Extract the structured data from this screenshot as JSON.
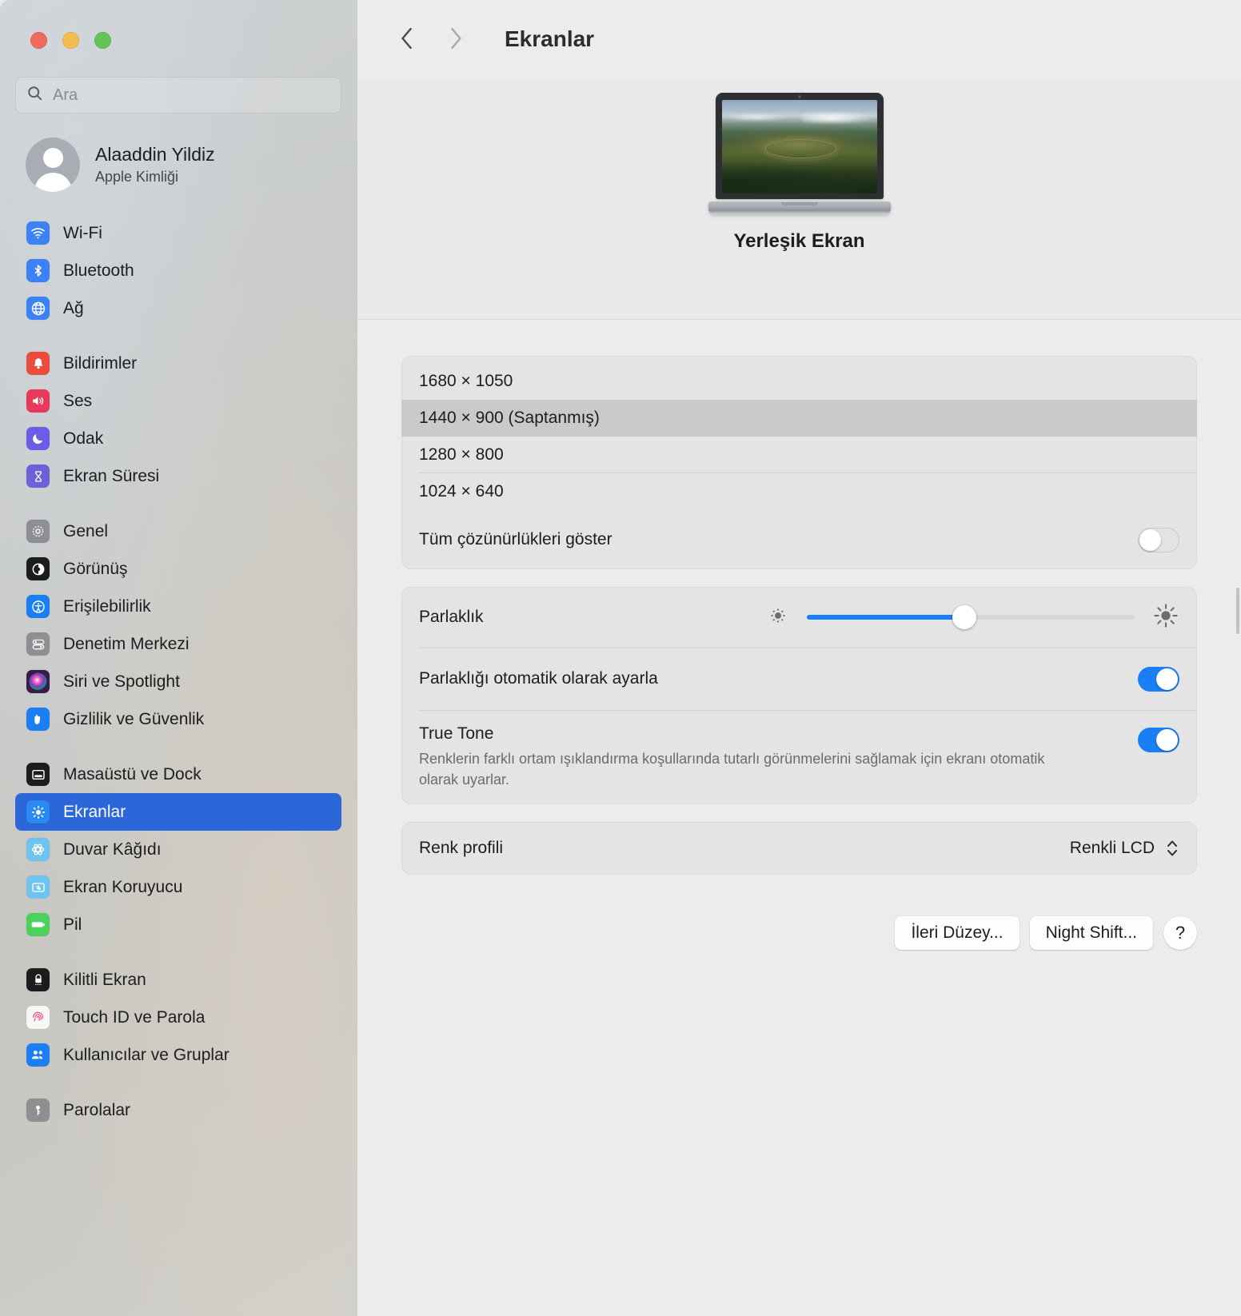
{
  "window": {
    "traffic_lights": [
      "close",
      "minimize",
      "zoom"
    ]
  },
  "sidebar": {
    "search": {
      "placeholder": "Ara",
      "value": "",
      "icon": "search-icon"
    },
    "account": {
      "name": "Alaaddin Yildiz",
      "subtitle": "Apple Kimliği",
      "avatar_icon": "person-avatar-icon"
    },
    "groups": [
      {
        "items": [
          {
            "label": "Wi-Fi",
            "icon": "wifi-icon",
            "color": "#3b82f6"
          },
          {
            "label": "Bluetooth",
            "icon": "bluetooth-icon",
            "color": "#3b82f6"
          },
          {
            "label": "Ağ",
            "icon": "globe-icon",
            "color": "#3b82f6"
          }
        ]
      },
      {
        "items": [
          {
            "label": "Bildirimler",
            "icon": "bell-icon",
            "color": "#eb4d3d"
          },
          {
            "label": "Ses",
            "icon": "speaker-icon",
            "color": "#e8395a"
          },
          {
            "label": "Odak",
            "icon": "moon-icon",
            "color": "#6c5ce7"
          },
          {
            "label": "Ekran Süresi",
            "icon": "hourglass-icon",
            "color": "#6f5fd8"
          }
        ]
      },
      {
        "items": [
          {
            "label": "Genel",
            "icon": "gear-icon",
            "color": "#8e8e93"
          },
          {
            "label": "Görünüş",
            "icon": "appearance-icon",
            "color": "#1c1c1e"
          },
          {
            "label": "Erişilebilirlik",
            "icon": "accessibility-icon",
            "color": "#1a7ef5"
          },
          {
            "label": "Denetim Merkezi",
            "icon": "control-center-icon",
            "color": "#8e8e93"
          },
          {
            "label": "Siri ve Spotlight",
            "icon": "siri-icon",
            "color": "#6b3fa0"
          },
          {
            "label": "Gizlilik ve Güvenlik",
            "icon": "hand-icon",
            "color": "#1a7ef5"
          }
        ]
      },
      {
        "items": [
          {
            "label": "Masaüstü ve Dock",
            "icon": "desktop-dock-icon",
            "color": "#1c1c1e"
          },
          {
            "label": "Ekranlar",
            "icon": "brightness-icon",
            "color": "#2b8af0",
            "selected": true
          },
          {
            "label": "Duvar Kâğıdı",
            "icon": "wallpaper-icon",
            "color": "#6fc3ef"
          },
          {
            "label": "Ekran Koruyucu",
            "icon": "screensaver-icon",
            "color": "#6fc3ef"
          },
          {
            "label": "Pil",
            "icon": "battery-icon",
            "color": "#4cd15f"
          }
        ]
      },
      {
        "items": [
          {
            "label": "Kilitli Ekran",
            "icon": "lock-icon",
            "color": "#1c1c1e"
          },
          {
            "label": "Touch ID ve Parola",
            "icon": "fingerprint-icon",
            "color": "#f7f7f7"
          },
          {
            "label": "Kullanıcılar ve Gruplar",
            "icon": "users-icon",
            "color": "#1a7ef5"
          }
        ]
      },
      {
        "items": [
          {
            "label": "Parolalar",
            "icon": "key-icon",
            "color": "#8e8e93"
          }
        ]
      }
    ]
  },
  "main": {
    "toolbar": {
      "back_icon": "chevron-left-icon",
      "forward_icon": "chevron-right-icon",
      "title": "Ekranlar"
    },
    "hero": {
      "display_icon": "macbook-display-icon",
      "caption": "Yerleşik Ekran"
    },
    "resolutions": {
      "options": [
        {
          "label": "1680 × 1050",
          "selected": false,
          "rule": false
        },
        {
          "label": "1440 × 900 (Saptanmış)",
          "selected": true,
          "rule": false
        },
        {
          "label": "1280 × 800",
          "selected": false,
          "rule": true
        },
        {
          "label": "1024 × 640",
          "selected": false,
          "rule": false
        }
      ],
      "show_all": {
        "label": "Tüm çözünürlükleri göster",
        "on": false
      }
    },
    "brightness": {
      "label": "Parlaklık",
      "value_percent": 48,
      "min_icon": "sun-low-icon",
      "max_icon": "sun-high-icon",
      "auto_adjust": {
        "label": "Parlaklığı otomatik olarak ayarla",
        "on": true
      },
      "true_tone": {
        "label": "True Tone",
        "description": "Renklerin farklı ortam ışıklandırma koşullarında tutarlı görünmelerini sağlamak için ekranı otomatik olarak uyarlar.",
        "on": true
      }
    },
    "color_profile": {
      "label": "Renk profili",
      "value": "Renkli LCD",
      "stepper_icon": "chevron-up-down-icon"
    },
    "buttons": {
      "advanced": "İleri Düzey...",
      "night_shift": "Night Shift...",
      "help": "?"
    }
  }
}
